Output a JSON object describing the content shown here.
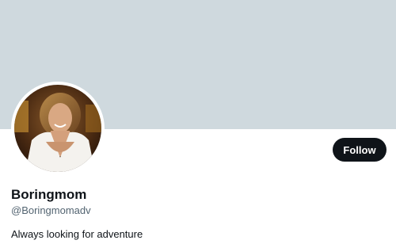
{
  "profile": {
    "display_name": "Boringmom",
    "handle": "@Boringmomadv",
    "bio": "Always looking for adventure"
  },
  "actions": {
    "follow_label": "Follow"
  },
  "colors": {
    "banner": "#cfd9de",
    "button_bg": "#0f1419",
    "button_text": "#ffffff",
    "handle_text": "#536471",
    "primary_text": "#0f1419"
  }
}
